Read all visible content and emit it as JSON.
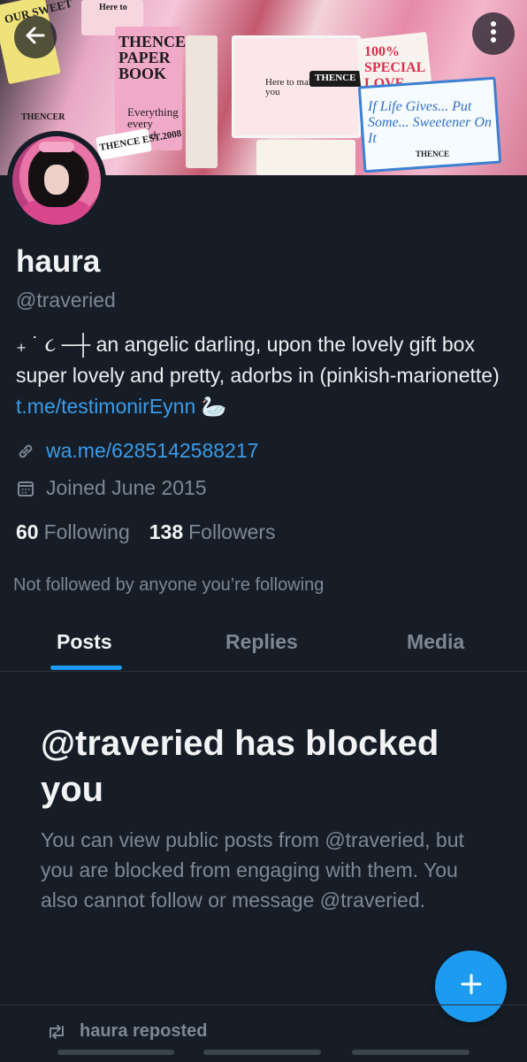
{
  "banner": {
    "texts": [
      "OUR SWEET",
      "Here to",
      "THENCE PAPER BOOK",
      "Everything every united",
      "THENCE EST.2008",
      "THENCER",
      "Here to make you",
      "THENCE",
      "100% SPECIAL LOVE",
      "If Life Gives... Put Some... Sweetener On It",
      "THENCE"
    ]
  },
  "header": {
    "back_icon": "arrow-left-icon",
    "more_icon": "more-vertical-icon"
  },
  "profile": {
    "name": "haura",
    "handle": "@traveried",
    "bio_text": "₊ ˙ ૮ ─┼ an angelic darling, upon the lovely gift box super lovely and pretty, adorbs in (pinkish-marionette) ",
    "bio_link": "t.me/testimonirEynn",
    "bio_emoji": "🦢",
    "website": "wa.me/6285142588217",
    "joined": "Joined June 2015",
    "following_count": "60",
    "following_label": "Following",
    "followers_count": "138",
    "followers_label": "Followers",
    "not_followed": "Not followed by anyone you’re following"
  },
  "tabs": [
    {
      "label": "Posts",
      "active": true
    },
    {
      "label": "Replies",
      "active": false
    },
    {
      "label": "Media",
      "active": false
    }
  ],
  "blocked": {
    "title": "@traveried has blocked you",
    "body": "You can view public posts from @traveried, but you are blocked from engaging with them. You also cannot follow or message @traveried."
  },
  "fab": {
    "icon": "plus-icon"
  },
  "repost": {
    "icon": "repost-icon",
    "label": "haura reposted"
  },
  "colors": {
    "accent": "#1d9bf0",
    "link": "#3b9be8",
    "background": "#161d26",
    "muted": "#7d8893"
  }
}
